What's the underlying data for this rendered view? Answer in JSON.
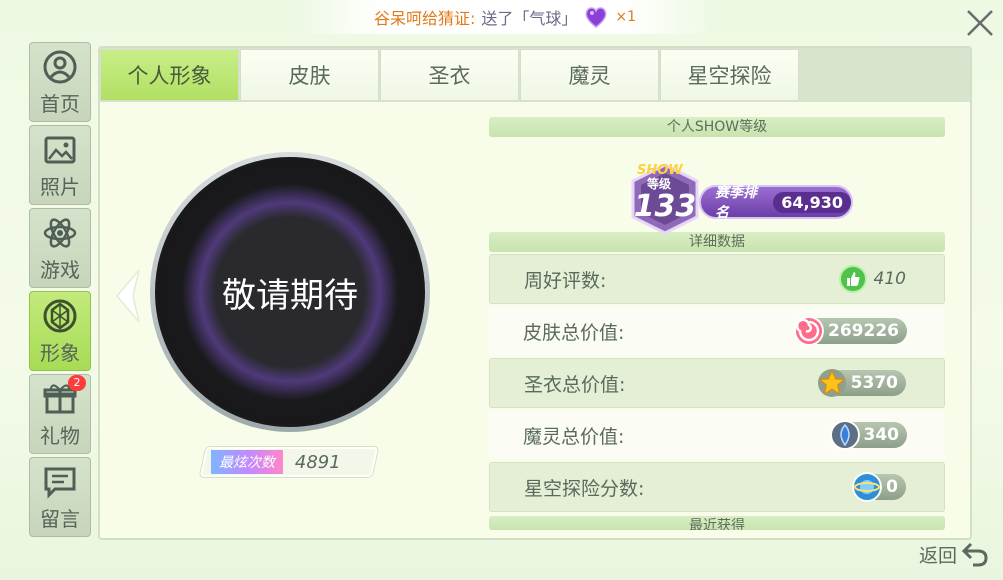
{
  "notice": {
    "sender": "谷呆呵给猜证:",
    "sent_text": "送了「气球」",
    "count": "×1"
  },
  "nav": [
    {
      "label": "首页",
      "icon": "home-icon"
    },
    {
      "label": "照片",
      "icon": "photo-icon"
    },
    {
      "label": "游戏",
      "icon": "atom-icon"
    },
    {
      "label": "形象",
      "icon": "avatar-icon",
      "active": true
    },
    {
      "label": "礼物",
      "icon": "gift-icon",
      "badge": "2"
    },
    {
      "label": "留言",
      "icon": "message-icon"
    }
  ],
  "tabs": [
    {
      "label": "个人形象",
      "active": true
    },
    {
      "label": "皮肤"
    },
    {
      "label": "圣衣"
    },
    {
      "label": "魔灵"
    },
    {
      "label": "星空探险"
    }
  ],
  "avatar": {
    "text": "敬请期待"
  },
  "fans": {
    "label": "最炫次数",
    "value": "4891"
  },
  "show_level": {
    "title": "个人SHOW等级",
    "badge_show": "SHOW",
    "badge_level_label": "等级",
    "level": "133",
    "rank_label": "赛季排名",
    "rank_value": "64,930"
  },
  "details": {
    "title": "详细数据",
    "rows": [
      {
        "label": "周好评数:",
        "value": "410",
        "icon": "thumbs-up-icon"
      },
      {
        "label": "皮肤总价值:",
        "value": "269226",
        "icon": "candy-icon"
      },
      {
        "label": "圣衣总价值:",
        "value": "5370",
        "icon": "star-icon"
      },
      {
        "label": "魔灵总价值:",
        "value": "340",
        "icon": "spirit-icon"
      },
      {
        "label": "星空探险分数:",
        "value": "0",
        "icon": "planet-icon"
      }
    ]
  },
  "recent": {
    "title": "最近获得"
  },
  "back": {
    "label": "返回"
  },
  "colors": {
    "accent": "#a7dc55",
    "panel": "#f7fde9"
  }
}
